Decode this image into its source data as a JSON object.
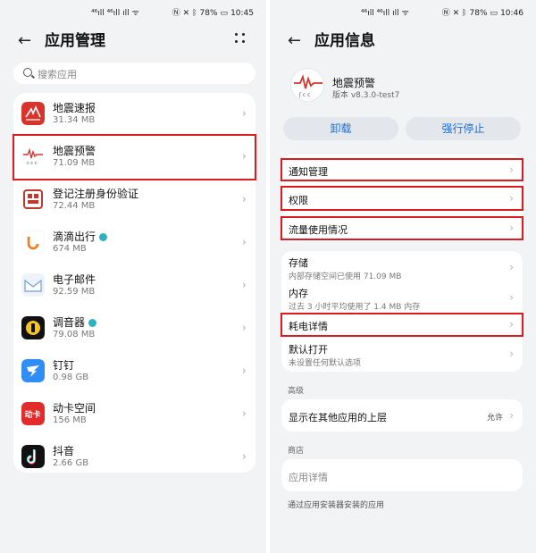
{
  "left_screen": {
    "status": {
      "signal": "⁴⁶ıll ⁴⁶ıll ıll",
      "battery": "78%",
      "time": "10:45"
    },
    "title": "应用管理",
    "search_placeholder": "搜索应用",
    "apps": [
      {
        "name": "地震速报",
        "size": "31.34 MB",
        "icon": "quake-news-icon"
      },
      {
        "name": "地震预警",
        "size": "71.09 MB",
        "icon": "quake-alert-icon"
      },
      {
        "name": "登记注册身份验证",
        "size": "72.44 MB",
        "icon": "id-verify-icon"
      },
      {
        "name": "滴滴出行",
        "size": "674 MB",
        "icon": "didi-icon"
      },
      {
        "name": "电子邮件",
        "size": "92.59 MB",
        "icon": "email-icon"
      },
      {
        "name": "调音器",
        "size": "79.08 MB",
        "icon": "tuner-icon"
      },
      {
        "name": "钉钉",
        "size": "0.98 GB",
        "icon": "dingtalk-icon"
      },
      {
        "name": "动卡空间",
        "size": "156 MB",
        "icon": "dongka-icon"
      },
      {
        "name": "抖音",
        "size": "2.66 GB",
        "icon": "douyin-icon"
      }
    ]
  },
  "right_screen": {
    "status": {
      "signal": "⁴⁶ıll ⁴⁶ıll ıll",
      "battery": "78%",
      "time": "10:46"
    },
    "title": "应用信息",
    "app_name": "地震预警",
    "app_version": "版本 v8.3.0-test7",
    "uninstall_label": "卸载",
    "force_stop_label": "强行停止",
    "notification_label": "通知管理",
    "permissions_label": "权限",
    "data_usage_label": "流量使用情况",
    "storage": {
      "label": "存储",
      "sub": "内部存储空间已使用 71.09 MB"
    },
    "memory": {
      "label": "内存",
      "sub": "过去 3 小时平均使用了 1.4 MB 内存"
    },
    "power_label": "耗电详情",
    "default_open": {
      "label": "默认打开",
      "sub": "未设置任何默认选项"
    },
    "advanced_section": "高级",
    "overlay": {
      "label": "显示在其他应用的上层",
      "value": "允许"
    },
    "store_section": "商店",
    "app_details_label": "应用详情",
    "footer_note": "通过应用安装器安装的应用"
  },
  "colors": {
    "highlight": "#e0191f",
    "accent": "#1a6fd6",
    "background": "#f1f3f5"
  }
}
